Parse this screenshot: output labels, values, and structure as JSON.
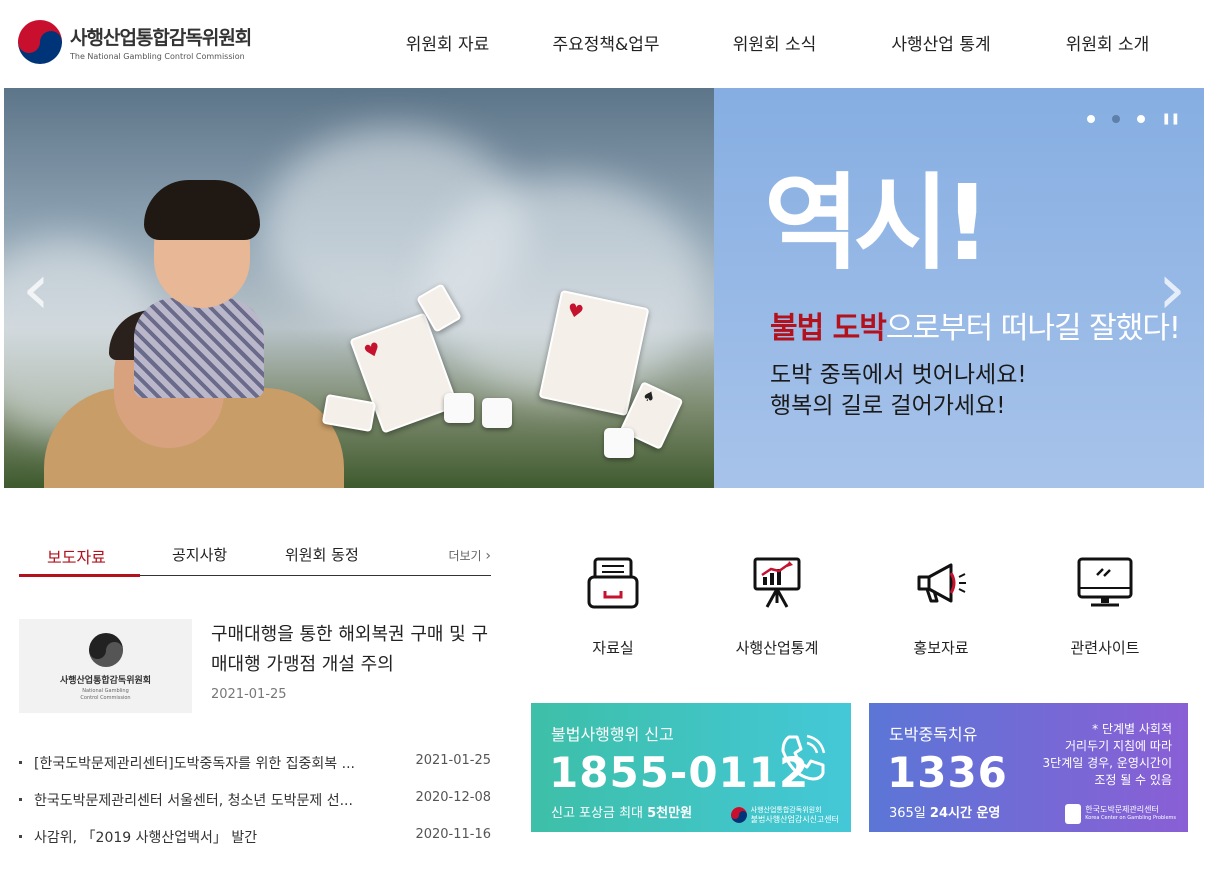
{
  "header": {
    "logo_ko": "사행산업통합감독위원회",
    "logo_en": "The National Gambling Control Commission",
    "nav": [
      {
        "label": "위원회 자료"
      },
      {
        "label": "주요정책&업무"
      },
      {
        "label": "위원회 소식"
      },
      {
        "label": "사행산업 통계"
      },
      {
        "label": "위원회 소개"
      }
    ]
  },
  "hero": {
    "headline": "역시!",
    "sub_red": "불법 도박",
    "sub_rest": "으로부터 떠나길 잘했다!",
    "line1": "도박 중독에서 벗어나세요!",
    "line2": "행복의 길로 걸어가세요!",
    "prev_icon": "chevron-left",
    "next_icon": "chevron-right",
    "pause_icon": "pause",
    "slides": 3,
    "active_slide": 2
  },
  "notice": {
    "tabs": [
      {
        "label": "보도자료",
        "active": true
      },
      {
        "label": "공지사항",
        "active": false
      },
      {
        "label": "위원회 동정",
        "active": false
      }
    ],
    "more": "더보기",
    "featured": {
      "thumb_name": "사행산업통합감독위원회",
      "thumb_en_1": "National Gambling",
      "thumb_en_2": "Control Commission",
      "title": "구매대행을 통한 해외복권 구매 및 구매대행 가맹점 개설 주의",
      "date": "2021-01-25"
    },
    "items": [
      {
        "title": "[한국도박문제관리센터]도박중독자를 위한 집중회복 ...",
        "date": "2021-01-25"
      },
      {
        "title": "한국도박문제관리센터 서울센터, 청소년 도박문제 선...",
        "date": "2020-12-08"
      },
      {
        "title": "사감위, 「2019 사행산업백서」 발간",
        "date": "2020-11-16"
      }
    ]
  },
  "quick_links": [
    {
      "label": "자료실",
      "icon": "archive-icon"
    },
    {
      "label": "사행산업통계",
      "icon": "chart-board-icon"
    },
    {
      "label": "홍보자료",
      "icon": "megaphone-icon"
    },
    {
      "label": "관련사이트",
      "icon": "monitor-icon"
    }
  ],
  "banners": {
    "report": {
      "title": "불법사행행위 신고",
      "number": "1855-0112",
      "sub_pre": "신고 포상금 최대 ",
      "sub_bold": "5천만원",
      "org_1": "사행산업통합감독위원회",
      "org_2": "불법사행산업감시신고센터"
    },
    "treatment": {
      "title": "도박중독치유",
      "number": "1336",
      "sub_pre": "365일 ",
      "sub_bold": "24시간 운영",
      "note_1": "* 단계별 사회적",
      "note_2": "거리두기 지침에 따라",
      "note_3": "3단계일 경우, 운영시간이",
      "note_4": "조정 될 수 있음",
      "org_1": "한국도박문제관리센터",
      "org_2": "Korea Center on Gambling Problems"
    }
  },
  "colors": {
    "accent_red": "#b3121d",
    "hero_blue": "#86aee2",
    "banner_teal": "#3dbfa8",
    "banner_purple": "#7a6ad6"
  }
}
